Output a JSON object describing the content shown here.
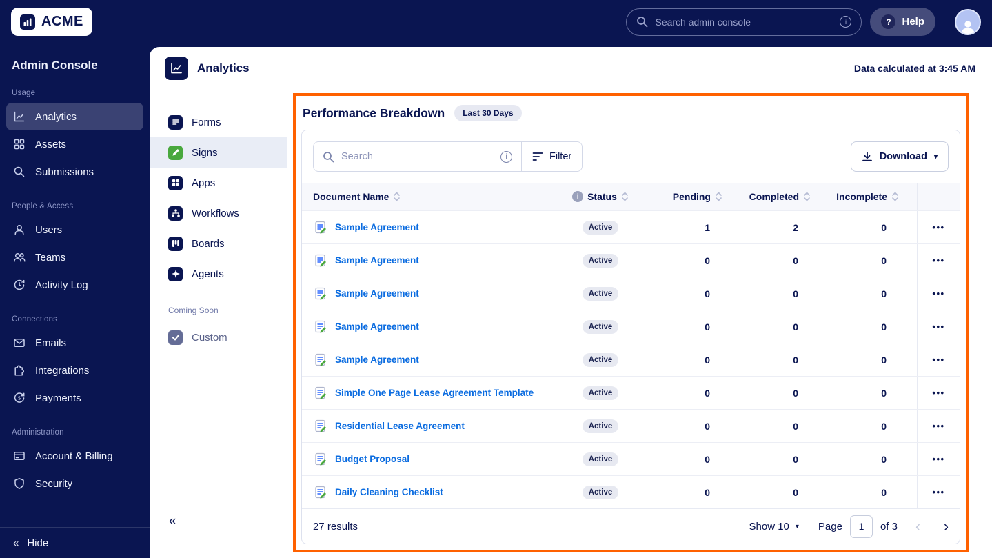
{
  "topbar": {
    "brand": "ACME",
    "search_placeholder": "Search admin console",
    "help_label": "Help"
  },
  "sidebar": {
    "title": "Admin Console",
    "sections": [
      {
        "label": "Usage",
        "items": [
          {
            "label": "Analytics"
          },
          {
            "label": "Assets"
          },
          {
            "label": "Submissions"
          }
        ]
      },
      {
        "label": "People & Access",
        "items": [
          {
            "label": "Users"
          },
          {
            "label": "Teams"
          },
          {
            "label": "Activity Log"
          }
        ]
      },
      {
        "label": "Connections",
        "items": [
          {
            "label": "Emails"
          },
          {
            "label": "Integrations"
          },
          {
            "label": "Payments"
          }
        ]
      },
      {
        "label": "Administration",
        "items": [
          {
            "label": "Account & Billing"
          },
          {
            "label": "Security"
          }
        ]
      }
    ],
    "hide_label": "Hide"
  },
  "header": {
    "title": "Analytics",
    "calculated_at": "Data calculated at 3:45 AM"
  },
  "subnav": {
    "items": [
      {
        "label": "Forms"
      },
      {
        "label": "Signs"
      },
      {
        "label": "Apps"
      },
      {
        "label": "Workflows"
      },
      {
        "label": "Boards"
      },
      {
        "label": "Agents"
      }
    ],
    "coming_soon_label": "Coming Soon",
    "coming_soon_item": {
      "label": "Custom"
    }
  },
  "panel": {
    "title": "Performance Breakdown",
    "period_badge": "Last 30 Days",
    "toolbar": {
      "search_placeholder": "Search",
      "filter_label": "Filter",
      "download_label": "Download"
    },
    "table": {
      "columns": {
        "name": "Document Name",
        "status": "Status",
        "pending": "Pending",
        "completed": "Completed",
        "incomplete": "Incomplete"
      },
      "rows": [
        {
          "name": "Sample Agreement",
          "status": "Active",
          "pending": "1",
          "completed": "2",
          "incomplete": "0"
        },
        {
          "name": "Sample Agreement",
          "status": "Active",
          "pending": "0",
          "completed": "0",
          "incomplete": "0"
        },
        {
          "name": "Sample Agreement",
          "status": "Active",
          "pending": "0",
          "completed": "0",
          "incomplete": "0"
        },
        {
          "name": "Sample Agreement",
          "status": "Active",
          "pending": "0",
          "completed": "0",
          "incomplete": "0"
        },
        {
          "name": "Sample Agreement",
          "status": "Active",
          "pending": "0",
          "completed": "0",
          "incomplete": "0"
        },
        {
          "name": "Simple One Page Lease Agreement Template",
          "status": "Active",
          "pending": "0",
          "completed": "0",
          "incomplete": "0"
        },
        {
          "name": "Residential Lease Agreement",
          "status": "Active",
          "pending": "0",
          "completed": "0",
          "incomplete": "0"
        },
        {
          "name": "Budget Proposal",
          "status": "Active",
          "pending": "0",
          "completed": "0",
          "incomplete": "0"
        },
        {
          "name": "Daily Cleaning Checklist",
          "status": "Active",
          "pending": "0",
          "completed": "0",
          "incomplete": "0"
        }
      ]
    },
    "pagination": {
      "results": "27 results",
      "show_label": "Show 10",
      "page_label": "Page",
      "page_value": "1",
      "of_label": "of 3"
    }
  },
  "icons": {
    "more_glyph": "•••",
    "caret_down": "▾",
    "chevron_left": "‹",
    "chevron_right": "›",
    "collapse": "«",
    "help_q": "?",
    "info": "i"
  },
  "colors": {
    "brand_navy": "#0a1551",
    "highlight_orange": "#ff6100",
    "link_blue": "#0b6ce0",
    "sign_green": "#49a83e"
  }
}
